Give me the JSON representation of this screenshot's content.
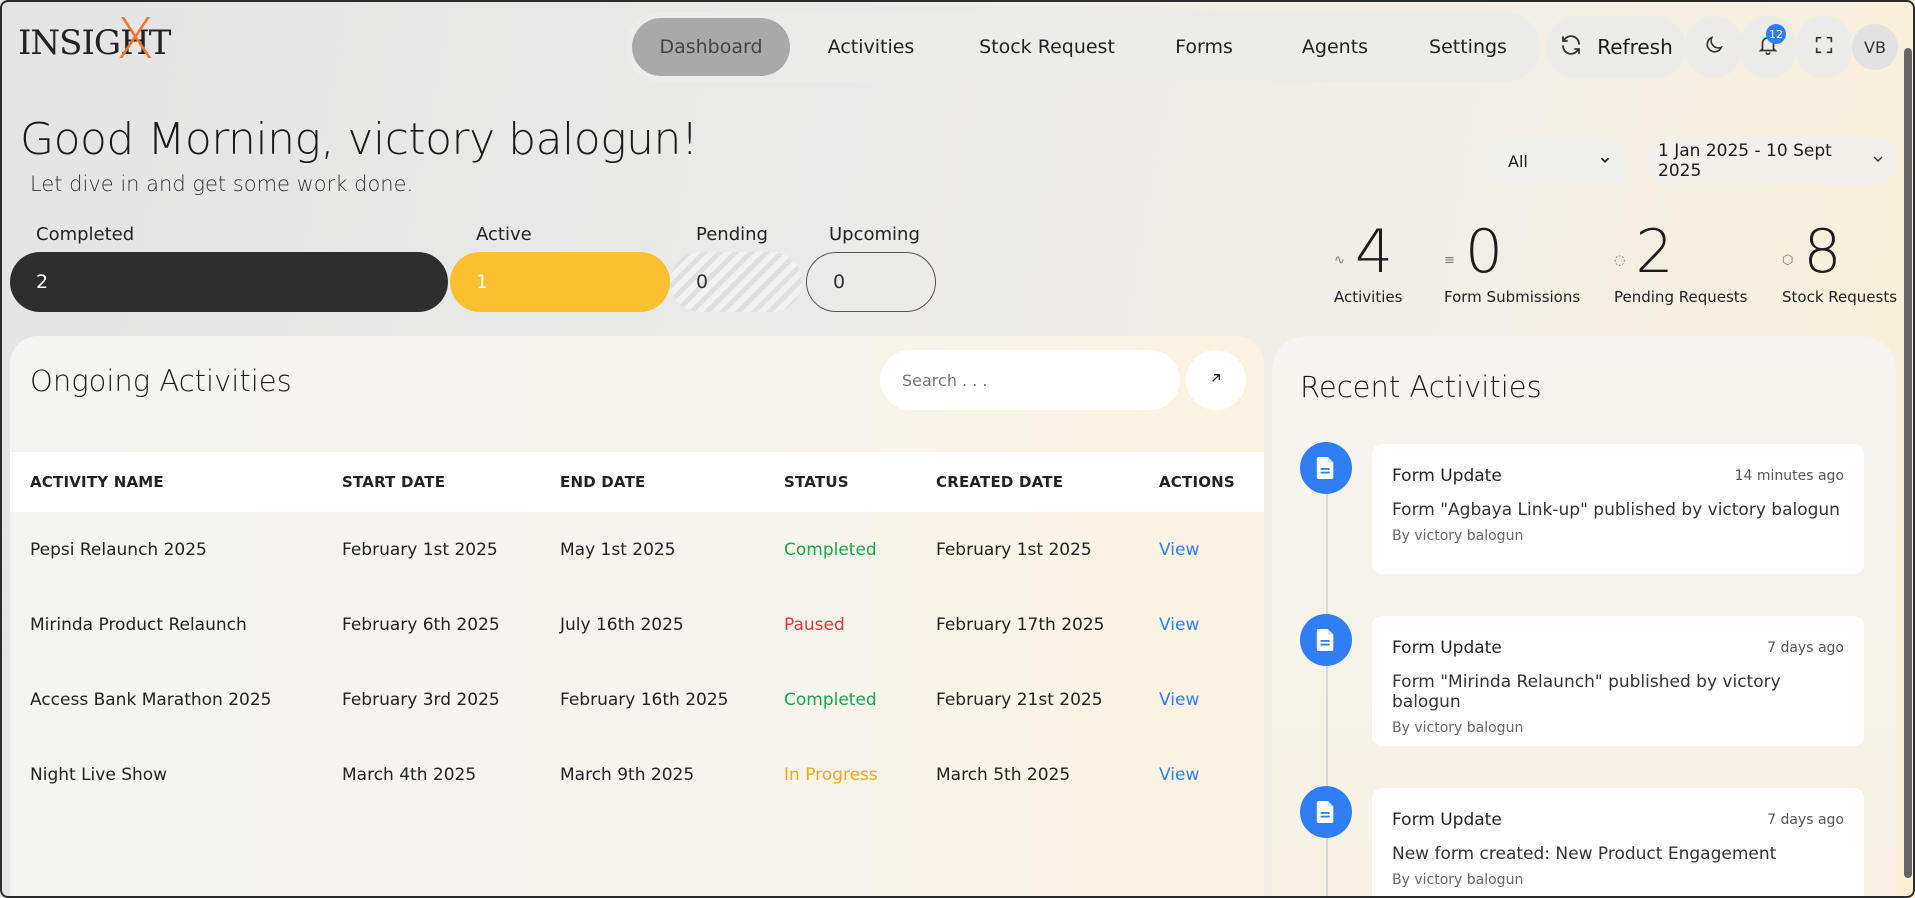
{
  "brand": {
    "logo_text": "INSIGHT",
    "logo_mark": "X"
  },
  "nav": {
    "items": [
      {
        "label": "Dashboard",
        "active": true
      },
      {
        "label": "Activities",
        "active": false
      },
      {
        "label": "Stock Request",
        "active": false
      },
      {
        "label": "Forms",
        "active": false
      },
      {
        "label": "Agents",
        "active": false
      },
      {
        "label": "Settings",
        "active": false
      }
    ]
  },
  "toolbar": {
    "refresh_label": "Refresh",
    "notification_count": "12",
    "avatar_initials": "VB"
  },
  "greeting": {
    "title": "Good Morning, victory balogun!",
    "subtitle": "Let dive in and get some work done."
  },
  "filters": {
    "type_selected": "All",
    "date_range": "1 Jan 2025 - 10 Sept 2025"
  },
  "status_pills": [
    {
      "label": "Completed",
      "value": "2"
    },
    {
      "label": "Active",
      "value": "1"
    },
    {
      "label": "Pending",
      "value": "0"
    },
    {
      "label": "Upcoming",
      "value": "0"
    }
  ],
  "stats": [
    {
      "value": "4",
      "label": "Activities",
      "icon": "activity-icon"
    },
    {
      "value": "0",
      "label": "Form Submissions",
      "icon": "list-icon"
    },
    {
      "value": "2",
      "label": "Pending Requests",
      "icon": "loader-icon"
    },
    {
      "value": "8",
      "label": "Stock Requests",
      "icon": "box-icon"
    }
  ],
  "ongoing": {
    "title": "Ongoing Activities",
    "search_placeholder": "Search . . .",
    "columns": [
      "ACTIVITY NAME",
      "START DATE",
      "END DATE",
      "STATUS",
      "CREATED DATE",
      "ACTIONS"
    ],
    "rows": [
      {
        "name": "Pepsi Relaunch 2025",
        "start": "February 1st 2025",
        "end": "May 1st 2025",
        "status": "Completed",
        "created": "February 1st 2025",
        "action": "View"
      },
      {
        "name": "Mirinda Product Relaunch",
        "start": "February 6th 2025",
        "end": "July 16th 2025",
        "status": "Paused",
        "created": "February 17th 2025",
        "action": "View"
      },
      {
        "name": "Access Bank Marathon 2025",
        "start": "February 3rd 2025",
        "end": "February 16th 2025",
        "status": "Completed",
        "created": "February 21st 2025",
        "action": "View"
      },
      {
        "name": "Night Live Show",
        "start": "March 4th 2025",
        "end": "March 9th 2025",
        "status": "In Progress",
        "created": "March 5th 2025",
        "action": "View"
      }
    ],
    "status_colors": {
      "Completed": "#1aa64a",
      "Paused": "#e5333d",
      "In Progress": "#f0a812"
    }
  },
  "recent": {
    "title": "Recent Activities",
    "items": [
      {
        "title": "Form Update",
        "time": "14 minutes ago",
        "desc": "Form \"Agbaya Link-up\" published by victory balogun",
        "by": "By victory balogun"
      },
      {
        "title": "Form Update",
        "time": "7 days ago",
        "desc": "Form \"Mirinda Relaunch\" published by victory balogun",
        "by": "By victory balogun"
      },
      {
        "title": "Form Update",
        "time": "7 days ago",
        "desc": "New form created: New Product Engagement",
        "by": "By victory balogun"
      }
    ]
  },
  "colors": {
    "accent_blue": "#2f7ef5",
    "brand_orange": "#f07a2c",
    "active_yellow": "#fbbf2f",
    "completed_dark": "#2e2e2e"
  }
}
